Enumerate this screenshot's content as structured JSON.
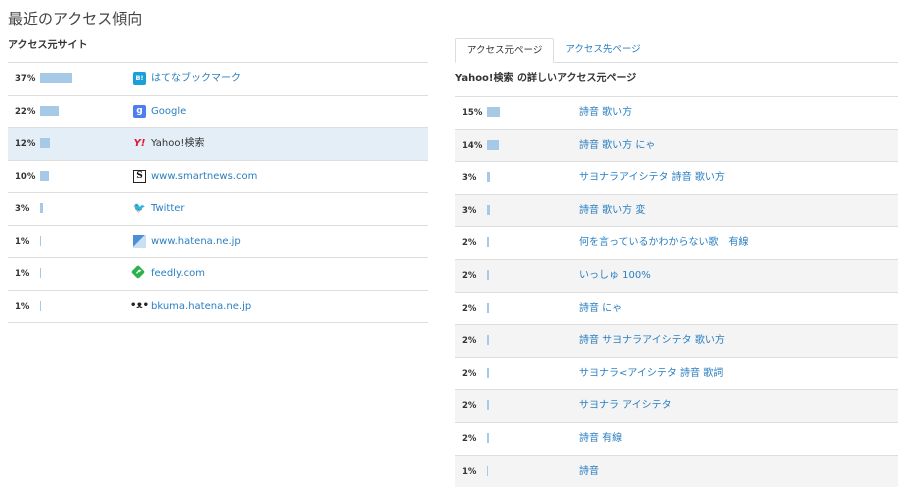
{
  "page": {
    "title": "最近のアクセス傾向"
  },
  "sources": {
    "title": "アクセス元サイト",
    "items": [
      {
        "pct": "37%",
        "value": 37,
        "name": "はてなブックマーク",
        "icon": "hatena-bookmark-icon",
        "glyph": "B!",
        "selected": false
      },
      {
        "pct": "22%",
        "value": 22,
        "name": "Google",
        "icon": "google-icon",
        "glyph": "g",
        "selected": false
      },
      {
        "pct": "12%",
        "value": 12,
        "name": "Yahoo!検索",
        "icon": "yahoo-icon",
        "glyph": "Y!",
        "selected": true
      },
      {
        "pct": "10%",
        "value": 10,
        "name": "www.smartnews.com",
        "icon": "smartnews-icon",
        "glyph": "S",
        "selected": false
      },
      {
        "pct": "3%",
        "value": 3,
        "name": "Twitter",
        "icon": "twitter-icon",
        "glyph": "🐦",
        "selected": false
      },
      {
        "pct": "1%",
        "value": 1,
        "name": "www.hatena.ne.jp",
        "icon": "hatena-icon",
        "glyph": "",
        "selected": false
      },
      {
        "pct": "1%",
        "value": 1,
        "name": "feedly.com",
        "icon": "feedly-icon",
        "glyph": "f",
        "selected": false
      },
      {
        "pct": "1%",
        "value": 1,
        "name": "bkuma.hatena.ne.jp",
        "icon": "bkuma-icon",
        "glyph": "•ᴥ•",
        "selected": false
      }
    ]
  },
  "tabs": [
    {
      "label": "アクセス元ページ",
      "active": true
    },
    {
      "label": "アクセス先ページ",
      "active": false
    }
  ],
  "detail": {
    "title": "Yahoo!検索 の詳しいアクセス元ページ",
    "items": [
      {
        "pct": "15%",
        "value": 15,
        "query": "詩音 歌い方"
      },
      {
        "pct": "14%",
        "value": 14,
        "query": "詩音 歌い方 にゃ"
      },
      {
        "pct": "3%",
        "value": 3,
        "query": "サヨナラアイシテタ 詩音 歌い方"
      },
      {
        "pct": "3%",
        "value": 3,
        "query": "詩音 歌い方 変"
      },
      {
        "pct": "2%",
        "value": 2,
        "query": "何を言っているかわからない歌　有線"
      },
      {
        "pct": "2%",
        "value": 2,
        "query": "いっしゅ 100%"
      },
      {
        "pct": "2%",
        "value": 2,
        "query": "詩音 にゃ"
      },
      {
        "pct": "2%",
        "value": 2,
        "query": "詩音 サヨナラアイシテタ 歌い方"
      },
      {
        "pct": "2%",
        "value": 2,
        "query": "サヨナラ<アイシテタ 詩音 歌詞"
      },
      {
        "pct": "2%",
        "value": 2,
        "query": "サヨナラ アイシテタ"
      },
      {
        "pct": "2%",
        "value": 2,
        "query": "詩音 有線"
      },
      {
        "pct": "1%",
        "value": 1,
        "query": "詩音"
      }
    ]
  },
  "colors": {
    "bar": "#a7c9e8",
    "link": "#2a7fc1",
    "selected_row": "#e3eef6"
  }
}
